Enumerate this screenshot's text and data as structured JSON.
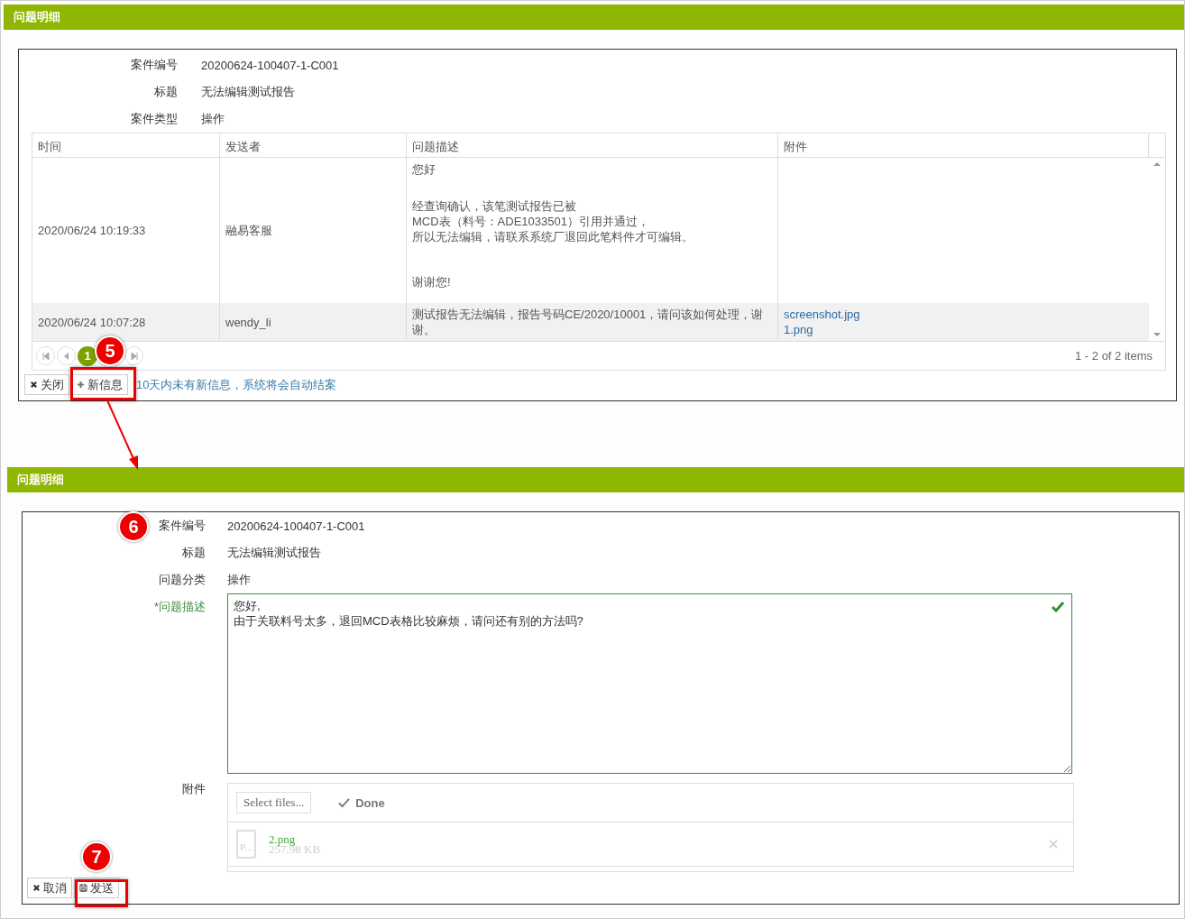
{
  "detail_panel": {
    "title": "问题明细",
    "fields": [
      {
        "label": "案件编号",
        "value": "20200624-100407-1-C001"
      },
      {
        "label": "标题",
        "value": "无法编辑测试报告"
      },
      {
        "label": "案件类型",
        "value": "操作"
      }
    ],
    "table": {
      "columns": [
        "时间",
        "发送者",
        "问题描述",
        "附件"
      ],
      "rows": [
        {
          "time": "2020/06/24 10:19:33",
          "sender": "融易客服",
          "description": [
            [
              "您好"
            ],
            [
              "经查询确认，该笔测试报告已被",
              "MCD表（料号：ADE1033501）引用并通过，",
              "所以无法编辑，请联系系统厂退回此笔料件才可编辑。"
            ],
            [
              "谢谢您!"
            ]
          ],
          "attachments": []
        },
        {
          "time": "2020/06/24 10:07:28",
          "sender": "wendy_li",
          "description": [
            [
              "测试报告无法编辑，报告号码CE/2020/10001，请问该如何处理，谢谢。"
            ]
          ],
          "attachments": [
            "screenshot.jpg",
            "1.png"
          ]
        }
      ]
    },
    "pager": {
      "pages": [
        {
          "label": "1",
          "selected": true
        }
      ],
      "summary": "1 - 2 of 2 items"
    },
    "buttons": [
      {
        "kind": "close",
        "label": "关闭"
      },
      {
        "kind": "add",
        "label": "新信息"
      }
    ],
    "notice": "10天内未有新信息，系统将会自动结案"
  },
  "reply_panel": {
    "title": "问题明细",
    "fields": [
      {
        "label": "案件编号",
        "value": "20200624-100407-1-C001"
      },
      {
        "label": "标题",
        "value": "无法编辑测试报告"
      },
      {
        "label": "问题分类",
        "value": "操作"
      }
    ],
    "description": {
      "label": "*问题描述",
      "required": true,
      "valid": true,
      "value": "您好,\n由于关联料号太多，退回MCD表格比较麻烦，请问还有别的方法吗?"
    },
    "attachments": {
      "label": "附件",
      "select_button": "Select files...",
      "status": "Done",
      "files": [
        {
          "thumb": "P...",
          "name": "2.png",
          "size": "257.98 KB"
        }
      ]
    },
    "buttons": [
      {
        "kind": "cancel",
        "label": "取消"
      },
      {
        "kind": "send",
        "label": "发送"
      }
    ]
  },
  "annotations": [
    {
      "number": "5"
    },
    {
      "number": "6"
    },
    {
      "number": "7"
    }
  ]
}
